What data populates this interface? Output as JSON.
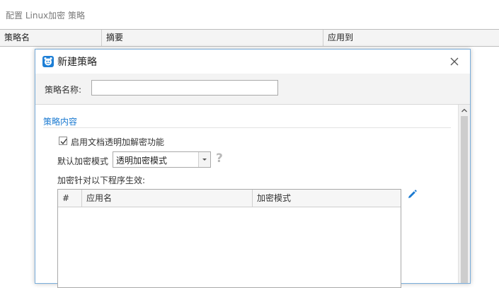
{
  "background_window": {
    "title": "配置 Linux加密 策略",
    "columns": [
      "策略名",
      "摘要",
      "应用到"
    ]
  },
  "dialog": {
    "title": "新建策略",
    "close_symbol": "×",
    "name_label": "策略名称:",
    "name_value": "",
    "section_title": "策略内容",
    "enable_checkbox": {
      "label": "启用文档透明加解密功能",
      "checked": true
    },
    "default_mode_label": "默认加密模式",
    "default_mode_value": "透明加密模式",
    "help_symbol": "?",
    "apply_label": "加密针对以下程序生效:",
    "table_columns": [
      "#",
      "应用名",
      "加密模式"
    ],
    "table_rows": []
  },
  "colors": {
    "accent": "#1b7ad1",
    "dialog_border": "#7aaedb",
    "help_icon": "#b8b8b8"
  },
  "icons": {
    "dialog": "app-logo-icon",
    "close": "close-icon",
    "edit": "pencil-edit-icon",
    "dropdown": "chevron-down-icon",
    "scroll_up": "chevron-up-icon"
  }
}
